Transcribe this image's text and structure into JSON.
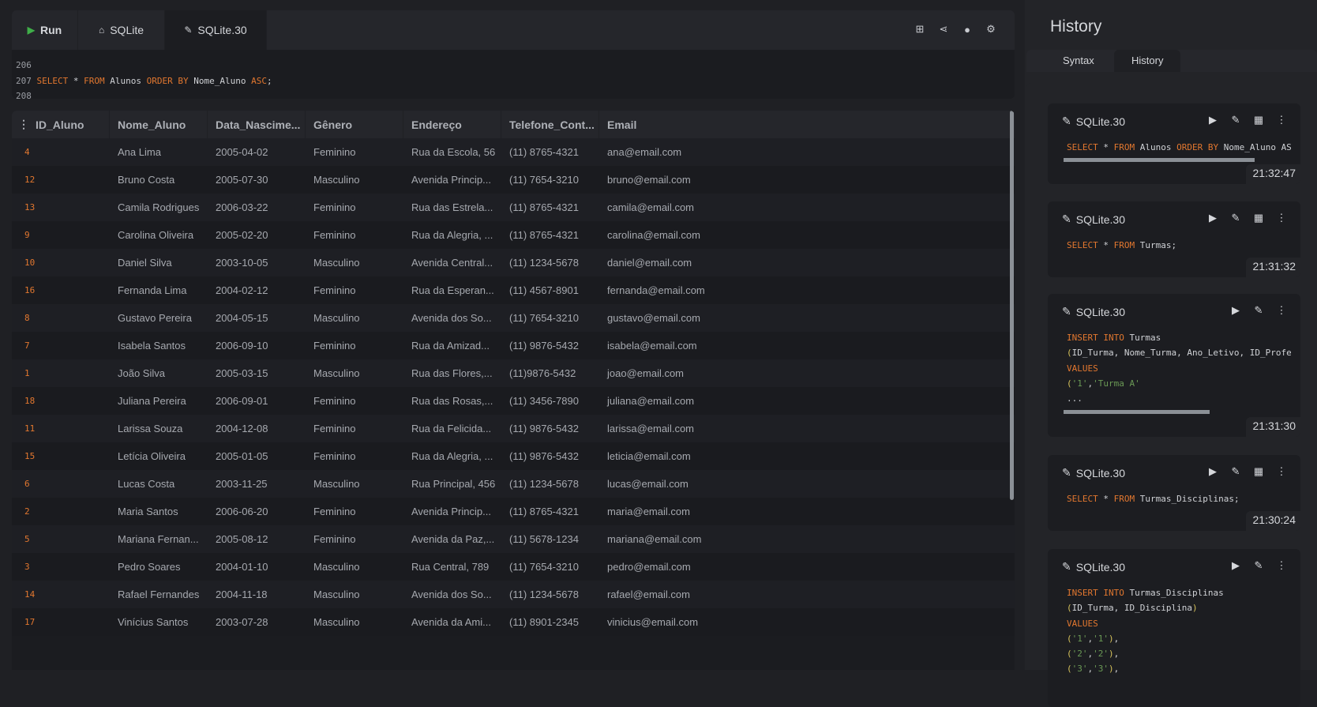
{
  "toolbar": {
    "run_label": "Run",
    "home_tab": "SQLite",
    "active_tab": "SQLite.30",
    "icons": [
      "add-icon",
      "share-icon",
      "user-icon",
      "gear-icon"
    ]
  },
  "editor": {
    "lines": [
      {
        "num": "206",
        "tokens": []
      },
      {
        "num": "207",
        "tokens": [
          {
            "t": "SELECT",
            "c": "kw"
          },
          {
            "t": " * ",
            "c": ""
          },
          {
            "t": "FROM",
            "c": "kw"
          },
          {
            "t": " Alunos ",
            "c": ""
          },
          {
            "t": "ORDER BY",
            "c": "kw"
          },
          {
            "t": " Nome_Aluno ",
            "c": ""
          },
          {
            "t": "ASC",
            "c": "kw"
          },
          {
            "t": ";",
            "c": ""
          }
        ]
      },
      {
        "num": "208",
        "tokens": []
      }
    ]
  },
  "table": {
    "columns": [
      "ID_Aluno",
      "Nome_Aluno",
      "Data_Nascime...",
      "Gênero",
      "Endereço",
      "Telefone_Cont...",
      "Email"
    ],
    "rows": [
      [
        "4",
        "Ana Lima",
        "2005-04-02",
        "Feminino",
        "Rua da Escola, 56",
        "(11) 8765-4321",
        "ana@email.com"
      ],
      [
        "12",
        "Bruno Costa",
        "2005-07-30",
        "Masculino",
        "Avenida Princip...",
        "(11) 7654-3210",
        "bruno@email.com"
      ],
      [
        "13",
        "Camila Rodrigues",
        "2006-03-22",
        "Feminino",
        "Rua das Estrela...",
        "(11) 8765-4321",
        "camila@email.com"
      ],
      [
        "9",
        "Carolina Oliveira",
        "2005-02-20",
        "Feminino",
        "Rua da Alegria, ...",
        "(11) 8765-4321",
        "carolina@email.com"
      ],
      [
        "10",
        "Daniel Silva",
        "2003-10-05",
        "Masculino",
        "Avenida Central...",
        "(11) 1234-5678",
        "daniel@email.com"
      ],
      [
        "16",
        "Fernanda Lima",
        "2004-02-12",
        "Feminino",
        "Rua da Esperan...",
        "(11) 4567-8901",
        "fernanda@email.com"
      ],
      [
        "8",
        "Gustavo Pereira",
        "2004-05-15",
        "Masculino",
        "Avenida dos So...",
        "(11) 7654-3210",
        "gustavo@email.com"
      ],
      [
        "7",
        "Isabela Santos",
        "2006-09-10",
        "Feminino",
        "Rua da Amizad...",
        "(11) 9876-5432",
        "isabela@email.com"
      ],
      [
        "1",
        "João Silva",
        "2005-03-15",
        "Masculino",
        "Rua das Flores,...",
        "(11)9876-5432",
        "joao@email.com"
      ],
      [
        "18",
        "Juliana Pereira",
        "2006-09-01",
        "Feminino",
        "Rua das Rosas,...",
        "(11) 3456-7890",
        "juliana@email.com"
      ],
      [
        "11",
        "Larissa Souza",
        "2004-12-08",
        "Feminino",
        "Rua da Felicida...",
        "(11) 9876-5432",
        "larissa@email.com"
      ],
      [
        "15",
        "Letícia Oliveira",
        "2005-01-05",
        "Feminino",
        "Rua da Alegria, ...",
        "(11) 9876-5432",
        "leticia@email.com"
      ],
      [
        "6",
        "Lucas Costa",
        "2003-11-25",
        "Masculino",
        "Rua Principal, 456",
        "(11) 1234-5678",
        "lucas@email.com"
      ],
      [
        "2",
        "Maria Santos",
        "2006-06-20",
        "Feminino",
        "Avenida Princip...",
        "(11) 8765-4321",
        "maria@email.com"
      ],
      [
        "5",
        "Mariana Fernan...",
        "2005-08-12",
        "Feminino",
        "Avenida da Paz,...",
        "(11) 5678-1234",
        "mariana@email.com"
      ],
      [
        "3",
        "Pedro Soares",
        "2004-01-10",
        "Masculino",
        "Rua Central, 789",
        "(11) 7654-3210",
        "pedro@email.com"
      ],
      [
        "14",
        "Rafael Fernandes",
        "2004-11-18",
        "Masculino",
        "Avenida dos So...",
        "(11) 1234-5678",
        "rafael@email.com"
      ],
      [
        "17",
        "Vinícius Santos",
        "2003-07-28",
        "Masculino",
        "Avenida da Ami...",
        "(11) 8901-2345",
        "vinicius@email.com"
      ]
    ]
  },
  "history_panel": {
    "title": "History",
    "tabs": [
      "Syntax",
      "History"
    ],
    "entries": [
      {
        "name": "SQLite.30",
        "time": "21:32:47",
        "grid": true,
        "scroll": 0.85,
        "lines": [
          [
            {
              "t": "SELECT",
              "c": "kw"
            },
            {
              "t": " * ",
              "c": ""
            },
            {
              "t": "FROM",
              "c": "kw"
            },
            {
              "t": " Alunos ",
              "c": ""
            },
            {
              "t": "ORDER BY",
              "c": "kw"
            },
            {
              "t": " Nome_Aluno ASC;",
              "c": ""
            }
          ]
        ]
      },
      {
        "name": "SQLite.30",
        "time": "21:31:32",
        "grid": true,
        "lines": [
          [
            {
              "t": "SELECT",
              "c": "kw"
            },
            {
              "t": " * ",
              "c": ""
            },
            {
              "t": "FROM",
              "c": "kw"
            },
            {
              "t": " Turmas;",
              "c": ""
            }
          ]
        ]
      },
      {
        "name": "SQLite.30",
        "time": "21:31:30",
        "grid": false,
        "scroll": 0.65,
        "lines": [
          [
            {
              "t": "INSERT INTO",
              "c": "kw"
            },
            {
              "t": " Turmas",
              "c": ""
            }
          ],
          [
            {
              "t": "(",
              "c": "par"
            },
            {
              "t": "ID_Turma, Nome_Turma, Ano_Letivo, ID_Professor",
              "c": ""
            }
          ],
          [
            {
              "t": "VALUES",
              "c": "kw"
            }
          ],
          [
            {
              "t": "(",
              "c": "par"
            },
            {
              "t": "'1'",
              "c": "str"
            },
            {
              "t": ",",
              "c": ""
            },
            {
              "t": "'Turma A'",
              "c": "str"
            }
          ],
          [
            {
              "t": "...",
              "c": ""
            }
          ]
        ]
      },
      {
        "name": "SQLite.30",
        "time": "21:30:24",
        "grid": true,
        "lines": [
          [
            {
              "t": "SELECT",
              "c": "kw"
            },
            {
              "t": " * ",
              "c": ""
            },
            {
              "t": "FROM",
              "c": "kw"
            },
            {
              "t": " Turmas_Disciplinas;",
              "c": ""
            }
          ]
        ]
      },
      {
        "name": "SQLite.30",
        "time": "",
        "grid": false,
        "lines": [
          [
            {
              "t": "INSERT INTO",
              "c": "kw"
            },
            {
              "t": " Turmas_Disciplinas",
              "c": ""
            }
          ],
          [
            {
              "t": "(",
              "c": "par"
            },
            {
              "t": "ID_Turma, ID_Disciplina",
              "c": ""
            },
            {
              "t": ")",
              "c": "par"
            }
          ],
          [
            {
              "t": "VALUES",
              "c": "kw"
            }
          ],
          [
            {
              "t": "(",
              "c": "par"
            },
            {
              "t": "'1'",
              "c": "str"
            },
            {
              "t": ",",
              "c": ""
            },
            {
              "t": "'1'",
              "c": "str"
            },
            {
              "t": ")",
              "c": "par"
            },
            {
              "t": ",",
              "c": ""
            }
          ],
          [
            {
              "t": "(",
              "c": "par"
            },
            {
              "t": "'2'",
              "c": "str"
            },
            {
              "t": ",",
              "c": ""
            },
            {
              "t": "'2'",
              "c": "str"
            },
            {
              "t": ")",
              "c": "par"
            },
            {
              "t": ",",
              "c": ""
            }
          ],
          [
            {
              "t": "(",
              "c": "par"
            },
            {
              "t": "'3'",
              "c": "str"
            },
            {
              "t": ",",
              "c": ""
            },
            {
              "t": "'3'",
              "c": "str"
            },
            {
              "t": ")",
              "c": "par"
            },
            {
              "t": ",",
              "c": ""
            }
          ]
        ]
      }
    ]
  }
}
